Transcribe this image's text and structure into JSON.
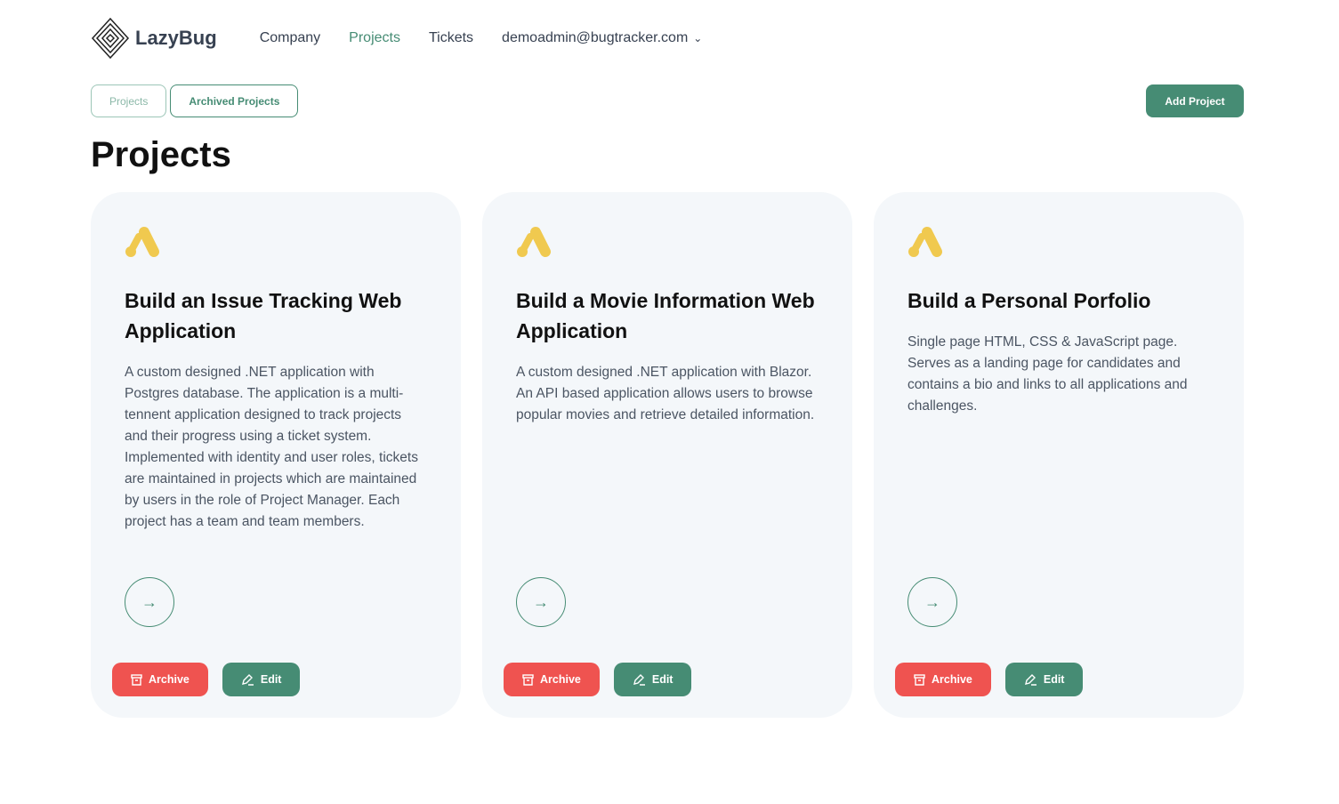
{
  "brand": "LazyBug",
  "nav": {
    "company": "Company",
    "projects": "Projects",
    "tickets": "Tickets",
    "user": "demoadmin@bugtracker.com"
  },
  "tabs": {
    "projects": "Projects",
    "archived": "Archived Projects"
  },
  "add_project": "Add Project",
  "page_title": "Projects",
  "colors": {
    "accent": "#468c74",
    "danger": "#ef5350",
    "icon": "#f0c94f"
  },
  "cards": [
    {
      "title": "Build an Issue Tracking Web Application",
      "description": "A custom designed .NET application with Postgres database. The application is a multi-tennent application designed to track projects and their progress using a ticket system. Implemented with identity and user roles, tickets are maintained in projects which are maintained by users in the role of Project Manager. Each project has a team and team members.",
      "archive": "Archive",
      "edit": "Edit"
    },
    {
      "title": "Build a Movie Information Web Application",
      "description": "A custom designed .NET application with Blazor. An API based application allows users to browse popular movies and retrieve detailed information.",
      "archive": "Archive",
      "edit": "Edit"
    },
    {
      "title": "Build a Personal Porfolio",
      "description": "Single page HTML, CSS & JavaScript page. Serves as a landing page for candidates and contains a bio and links to all applications and challenges.",
      "archive": "Archive",
      "edit": "Edit"
    }
  ]
}
